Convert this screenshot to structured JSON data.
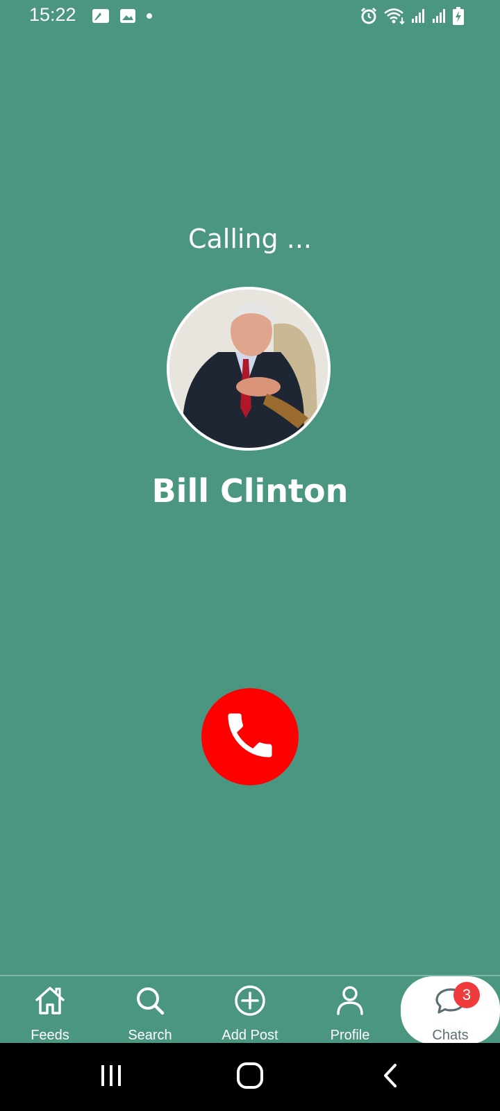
{
  "status_bar": {
    "time": "15:22",
    "left_icons": [
      "notification-icon",
      "gallery-icon",
      "dot-icon"
    ],
    "right_icons": [
      "alarm-icon",
      "wifi-icon",
      "signal-icon",
      "signal-icon",
      "battery-charging-icon"
    ]
  },
  "call": {
    "status": "Calling ...",
    "contact_name": "Bill Clinton",
    "end_call_color": "#ff0000"
  },
  "bottom_nav": {
    "items": [
      {
        "label": "Feeds",
        "icon": "home-icon"
      },
      {
        "label": "Search",
        "icon": "search-icon"
      },
      {
        "label": "Add Post",
        "icon": "add-circle-icon"
      },
      {
        "label": "Profile",
        "icon": "person-icon"
      },
      {
        "label": "Chats",
        "icon": "chat-icon",
        "badge": "3",
        "active": true
      }
    ]
  },
  "colors": {
    "background": "#4a9680",
    "badge": "#ef3b3b",
    "active_label": "#5a6e72"
  }
}
